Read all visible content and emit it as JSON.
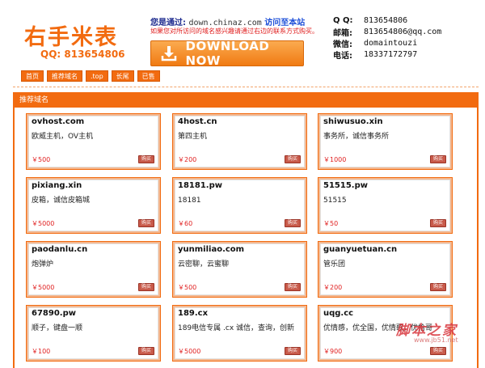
{
  "header": {
    "logo": "右手米表",
    "qq_line": "QQ: 813654806",
    "visit_label": "您是通过:",
    "visit_domain": "down.chinaz.com",
    "visit_link": "访问至本站",
    "notice": "如果您对所访问的域名感兴趣请通过右边的联系方式购买。",
    "download_label": "DOWNLOAD NOW"
  },
  "contact": [
    {
      "key": "Q Q:",
      "value": "813654806"
    },
    {
      "key": "邮箱:",
      "value": "813654806@qq.com"
    },
    {
      "key": "微信:",
      "value": "domaintouzi"
    },
    {
      "key": "电话:",
      "value": "18337172797"
    }
  ],
  "nav": [
    "首页",
    "推荐域名",
    ".top",
    "长尾",
    "已售"
  ],
  "panel_title": "推荐域名",
  "buy_label": "购买",
  "cards": [
    {
      "domain": "ovhost.com",
      "desc": "欧威主机，OV主机",
      "price": "￥500"
    },
    {
      "domain": "4host.cn",
      "desc": "第四主机",
      "price": "￥200"
    },
    {
      "domain": "shiwusuo.xin",
      "desc": "事务所，诚信事务所",
      "price": "￥1000"
    },
    {
      "domain": "pixiang.xin",
      "desc": "皮箱，诚信皮箱城",
      "price": "￥5000"
    },
    {
      "domain": "18181.pw",
      "desc": "18181",
      "price": "￥60"
    },
    {
      "domain": "51515.pw",
      "desc": "51515",
      "price": "￥50"
    },
    {
      "domain": "paodanlu.cn",
      "desc": "炮弹炉",
      "price": "￥5000"
    },
    {
      "domain": "yunmiliao.com",
      "desc": "云密聊，云蜜聊",
      "price": "￥500"
    },
    {
      "domain": "guanyuetuan.cn",
      "desc": "管乐团",
      "price": "￥200"
    },
    {
      "domain": "67890.pw",
      "desc": "顺子，键盘一顺",
      "price": "￥100"
    },
    {
      "domain": "189.cx",
      "desc": "189电信专属 .cx 诚信，查询，创新",
      "price": "￥5000"
    },
    {
      "domain": "uqg.cc",
      "desc": "优情感，优全国，优情歌，优拾哥",
      "price": "￥900"
    }
  ],
  "watermark": {
    "big": "脚本之家",
    "small": "www.jb51.net"
  },
  "colors": {
    "accent": "#f26b10",
    "price": "#e02020"
  }
}
